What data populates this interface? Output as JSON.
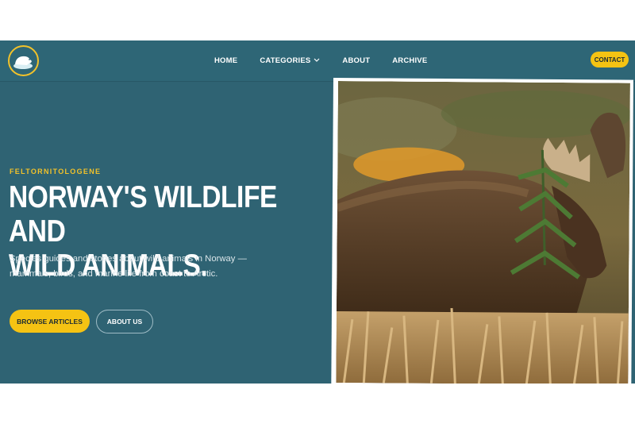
{
  "header": {
    "logo_icon": "beaver-logo-icon",
    "nav": [
      {
        "label": "HOME"
      },
      {
        "label": "CATEGORIES",
        "icon": "chevron-down-icon"
      },
      {
        "label": "ABOUT"
      },
      {
        "label": "ARCHIVE"
      }
    ],
    "contact_label": "CONTACT"
  },
  "hero": {
    "eyebrow": "FELTORNITOLOGENE",
    "headline_line1": "NORWAY'S WILDLIFE AND",
    "headline_line2": "WILD ANIMALS.",
    "description": "Species guides and stories about wild animals in Norway — mammals, birds, and marine life from coast to Arctic.",
    "primary_button": "BROWSE ARTICLES",
    "secondary_button": "ABOUT US",
    "image_subject": "moose-photo"
  },
  "colors": {
    "background": "#2f6373",
    "accent": "#f5c313",
    "text": "#ffffff"
  }
}
